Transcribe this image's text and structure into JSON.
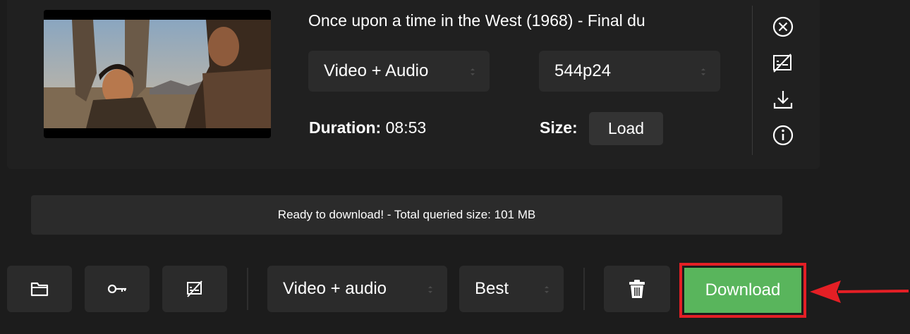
{
  "item": {
    "title": "Once upon a time in the West (1968) - Final du",
    "format_select": "Video + Audio",
    "quality_select": "544p24",
    "duration_label": "Duration:",
    "duration_value": "08:53",
    "size_label": "Size:",
    "load_button": "Load",
    "side_icons": [
      "close-circle-icon",
      "no-subtitles-icon",
      "download-icon",
      "info-icon"
    ]
  },
  "status_text": "Ready to download! - Total queried size: 101 MB",
  "toolbar": {
    "folder_icon": "folder-icon",
    "key_icon": "key-icon",
    "subtitles_icon": "no-subtitles-icon",
    "format_select": "Video + audio",
    "quality_select": "Best",
    "trash_icon": "trash-icon",
    "download_label": "Download"
  },
  "colors": {
    "background": "#1c1c1c",
    "panel": "#2b2b2b",
    "download": "#59b55c",
    "highlight": "#e41f25"
  }
}
